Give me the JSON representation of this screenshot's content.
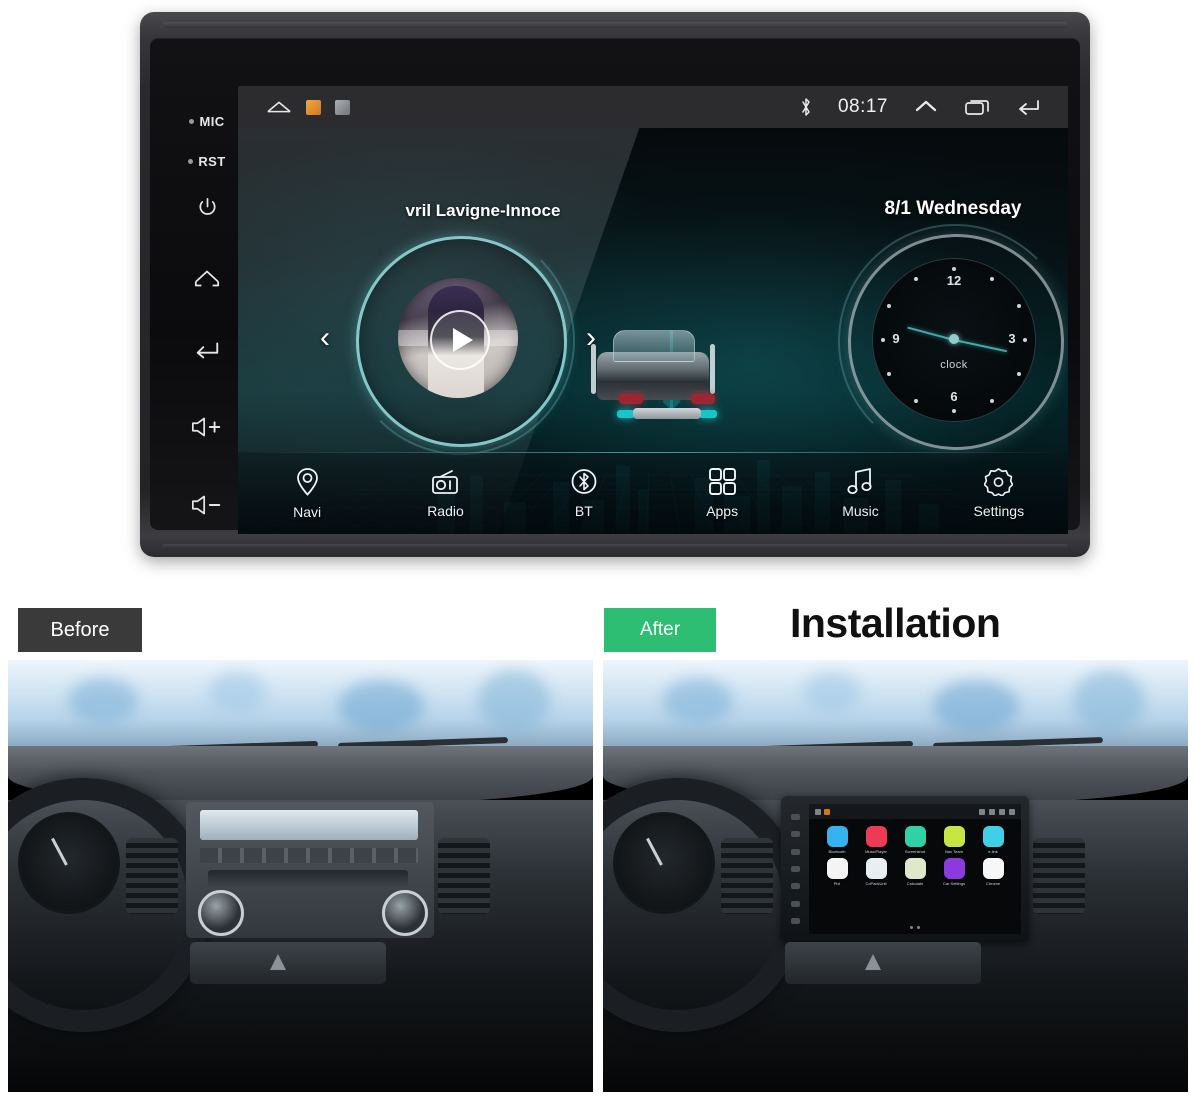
{
  "device": {
    "hard_keys": [
      {
        "name": "mic",
        "label": "MIC",
        "type": "dot-label"
      },
      {
        "name": "reset",
        "label": "RST",
        "type": "dot-label"
      },
      {
        "name": "power",
        "label": "",
        "type": "power-icon"
      },
      {
        "name": "home",
        "label": "",
        "type": "home-icon"
      },
      {
        "name": "back",
        "label": "",
        "type": "back-icon"
      },
      {
        "name": "volume-up",
        "label": "+",
        "type": "volume-up-icon"
      },
      {
        "name": "volume-down",
        "label": "−",
        "type": "volume-down-icon"
      }
    ]
  },
  "status_bar": {
    "home_icon": "home-icon",
    "notifications": [
      {
        "name": "music-notification-icon",
        "color": "#e08a28"
      },
      {
        "name": "image-notification-icon",
        "color": "#8d9196"
      }
    ],
    "bluetooth_icon": "bluetooth-icon",
    "clock": "08:17",
    "expand_icon": "chevron-up-icon",
    "recents_icon": "recents-icon",
    "back_icon": "back-arrow-icon"
  },
  "music_widget": {
    "title": "vril Lavigne-Innoce",
    "prev_icon": "‹",
    "next_icon": "›",
    "play_icon": "play-icon"
  },
  "clock_widget": {
    "date": "8/1  Wednesday",
    "numerals": [
      "12",
      "3",
      "6",
      "9"
    ],
    "label": "clock"
  },
  "dock": {
    "items": [
      {
        "label": "Navi",
        "icon": "location-pin-icon"
      },
      {
        "label": "Radio",
        "icon": "radio-icon"
      },
      {
        "label": "BT",
        "icon": "bluetooth-icon"
      },
      {
        "label": "Apps",
        "icon": "apps-grid-icon"
      },
      {
        "label": "Music",
        "icon": "music-note-icon"
      },
      {
        "label": "Settings",
        "icon": "gear-icon"
      }
    ]
  },
  "comparison": {
    "before_tag": "Before",
    "after_tag": "After",
    "title": "Installation",
    "before_badge_color": "#3a3a3a",
    "after_badge_color": "#2dbd73"
  },
  "installed_unit": {
    "apps": [
      {
        "label": "Bluetooth",
        "color": "#34b3ef"
      },
      {
        "label": "MusicPlayer",
        "color": "#ee3a55"
      },
      {
        "label": "Screenshot",
        "color": "#2fd1a5"
      },
      {
        "label": "Nav Team",
        "color": "#c7e643"
      },
      {
        "label": "e-link",
        "color": "#3fd0e8"
      },
      {
        "label": "Pixl",
        "color": "#f4f4f4"
      },
      {
        "label": "CoPackUnit",
        "color": "#e9eef2"
      },
      {
        "label": "Calculate",
        "color": "#dfe8c8"
      },
      {
        "label": "Car Settings",
        "color": "#8a3bdd"
      },
      {
        "label": "Chrome",
        "color": "#f7f7f7"
      }
    ]
  }
}
